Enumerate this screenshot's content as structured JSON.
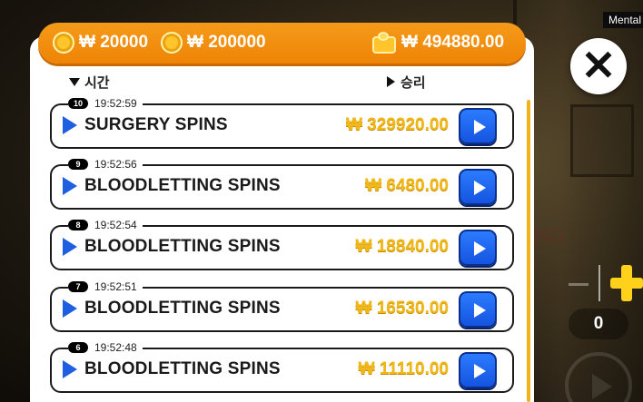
{
  "header": {
    "coin_value_1": "₩ 20000",
    "coin_value_2": "₩ 200000",
    "balance": "₩ 494880.00"
  },
  "sort": {
    "time_label": "시간",
    "win_label": "승리"
  },
  "history": [
    {
      "index": "10",
      "time": "19:52:59",
      "name": "SURGERY SPINS",
      "amount": "₩ 329920.00"
    },
    {
      "index": "9",
      "time": "19:52:56",
      "name": "BLOODLETTING SPINS",
      "amount": "₩ 6480.00"
    },
    {
      "index": "8",
      "time": "19:52:54",
      "name": "BLOODLETTING SPINS",
      "amount": "₩ 18840.00"
    },
    {
      "index": "7",
      "time": "19:52:51",
      "name": "BLOODLETTING SPINS",
      "amount": "₩ 16530.00"
    },
    {
      "index": "6",
      "time": "19:52:48",
      "name": "BLOODLETTING SPINS",
      "amount": "₩ 11110.00"
    }
  ],
  "side": {
    "tag": "Mental",
    "bet_count": "0",
    "close_symbol": "✕"
  },
  "colors": {
    "header_orange": "#ef8406",
    "amount_gold": "#f0b818",
    "play_blue": "#1d5fe0"
  },
  "icons": {
    "coin": "coin-icon",
    "wallet": "wallet-icon",
    "play": "play-icon",
    "close": "close-icon",
    "plus": "plus-icon"
  }
}
